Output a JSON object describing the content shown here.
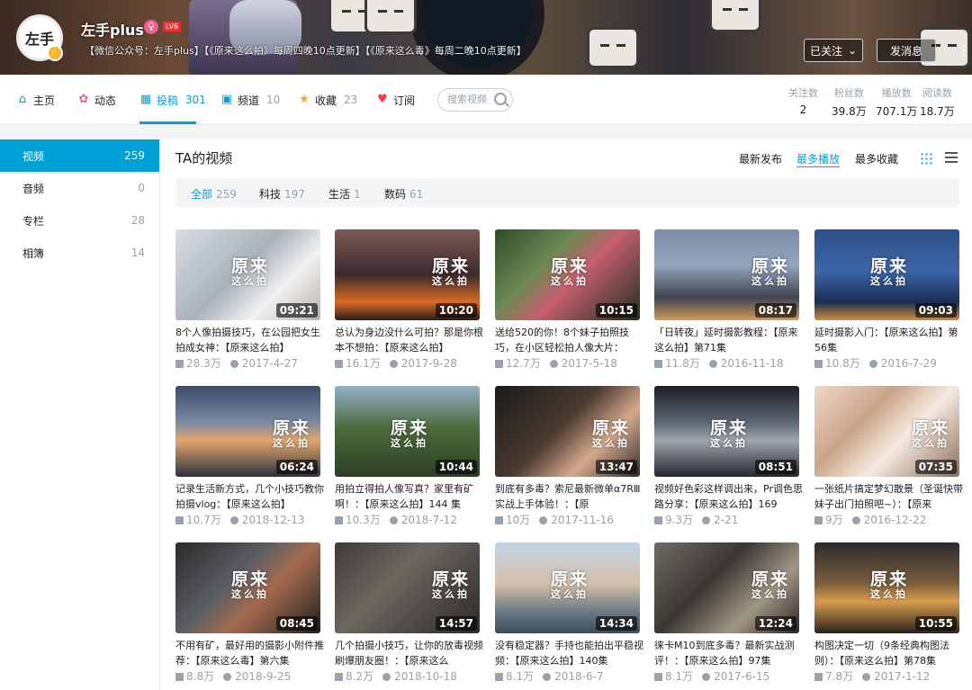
{
  "header": {
    "avatar_text": "左手",
    "username": "左手plus",
    "level": "LV6",
    "signature": "【微信公众号：左手plus】【《原来这么拍》每周四晚10点更新】【《原来这么毒》每周二晚10点更新】",
    "follow_label": "已关注",
    "message_label": "发消息"
  },
  "nav": {
    "items": [
      {
        "label": "主页",
        "count": "",
        "icon": "home-icon"
      },
      {
        "label": "动态",
        "count": "",
        "icon": "activity-icon"
      },
      {
        "label": "投稿",
        "count": "301",
        "icon": "upload-icon"
      },
      {
        "label": "频道",
        "count": "10",
        "icon": "channel-icon"
      },
      {
        "label": "收藏",
        "count": "23",
        "icon": "star-icon"
      },
      {
        "label": "订阅",
        "count": "",
        "icon": "heart-icon"
      }
    ],
    "search_placeholder": "搜索视频",
    "stats": [
      {
        "label": "关注数",
        "value": "2"
      },
      {
        "label": "粉丝数",
        "value": "39.8万"
      },
      {
        "label": "播放数",
        "value": "707.1万"
      },
      {
        "label": "阅读数",
        "value": "18.7万"
      }
    ]
  },
  "sidebar": {
    "items": [
      {
        "label": "视频",
        "count": "259"
      },
      {
        "label": "音频",
        "count": "0"
      },
      {
        "label": "专栏",
        "count": "28"
      },
      {
        "label": "相簿",
        "count": "14"
      }
    ]
  },
  "main": {
    "title": "TA的视频",
    "sort": [
      "最新发布",
      "最多播放",
      "最多收藏"
    ],
    "filters": [
      {
        "label": "全部",
        "count": "259"
      },
      {
        "label": "科技",
        "count": "197"
      },
      {
        "label": "生活",
        "count": "1"
      },
      {
        "label": "数码",
        "count": "61"
      }
    ],
    "videos": [
      {
        "title": "8个人像拍摄技巧，在公园把女生拍成女神：【原来这么拍】",
        "duration": "09:21",
        "plays": "28.3万",
        "date": "2017-4-27"
      },
      {
        "title": "总认为身边没什么可拍？那是你根本不想拍：【原来这么拍】",
        "duration": "10:20",
        "plays": "16.1万",
        "date": "2017-9-28"
      },
      {
        "title": "送给520的你！8个妹子拍照技巧，在小区轻松拍人像大片：",
        "duration": "10:15",
        "plays": "12.7万",
        "date": "2017-5-18"
      },
      {
        "title": "「日转夜」延时摄影教程：【原来这么拍】第71集",
        "duration": "08:17",
        "plays": "11.8万",
        "date": "2016-11-18"
      },
      {
        "title": "延时摄影入门：【原来这么拍】第56集",
        "duration": "09:03",
        "plays": "10.8万",
        "date": "2016-7-29"
      },
      {
        "title": "记录生活新方式，几个小技巧教你拍摄vlog：【原来这么拍】",
        "duration": "06:24",
        "plays": "10.7万",
        "date": "2018-12-13"
      },
      {
        "title": "用拍立得拍人像写真？家里有矿啊！：【原来这么拍】144 集",
        "duration": "10:44",
        "plays": "10.3万",
        "date": "2018-7-12"
      },
      {
        "title": "到底有多毒？索尼最新微单α7RⅢ实战上手体验！：【原",
        "duration": "13:47",
        "plays": "10万",
        "date": "2017-11-16"
      },
      {
        "title": "视频好色彩这样调出来，Pr调色思路分享：【原来这么拍】169",
        "duration": "08:51",
        "plays": "9.3万",
        "date": "2-21"
      },
      {
        "title": "一张纸片搞定梦幻散景（圣诞快带妹子出门拍照吧~）：【原来",
        "duration": "07:35",
        "plays": "9万",
        "date": "2016-12-22"
      },
      {
        "title": "不用有矿，最好用的摄影小附件推荐：【原来这么毒】第六集",
        "duration": "08:45",
        "plays": "8.8万",
        "date": "2018-9-25"
      },
      {
        "title": "几个拍摄小技巧，让你的放毒视频刷爆朋友圈！：【原来这么",
        "duration": "14:57",
        "plays": "8.2万",
        "date": "2018-10-18"
      },
      {
        "title": "没有稳定器？手持也能拍出平稳视频：【原来这么拍】140集",
        "duration": "14:34",
        "plays": "8.1万",
        "date": "2018-6-7"
      },
      {
        "title": "徕卡M10到底多毒？最新实战测评！：【原来这么拍】97集",
        "duration": "12:24",
        "plays": "8.1万",
        "date": "2017-6-15"
      },
      {
        "title": "构图决定一切（9条经典构图法则）：【原来这么拍】第78集",
        "duration": "10:55",
        "plays": "7.8万",
        "date": "2017-1-12"
      }
    ],
    "watermark_big": "原来",
    "watermark_small": "这么拍"
  },
  "colors": {
    "accent": "#00a1d6",
    "muted": "#99a2aa"
  }
}
